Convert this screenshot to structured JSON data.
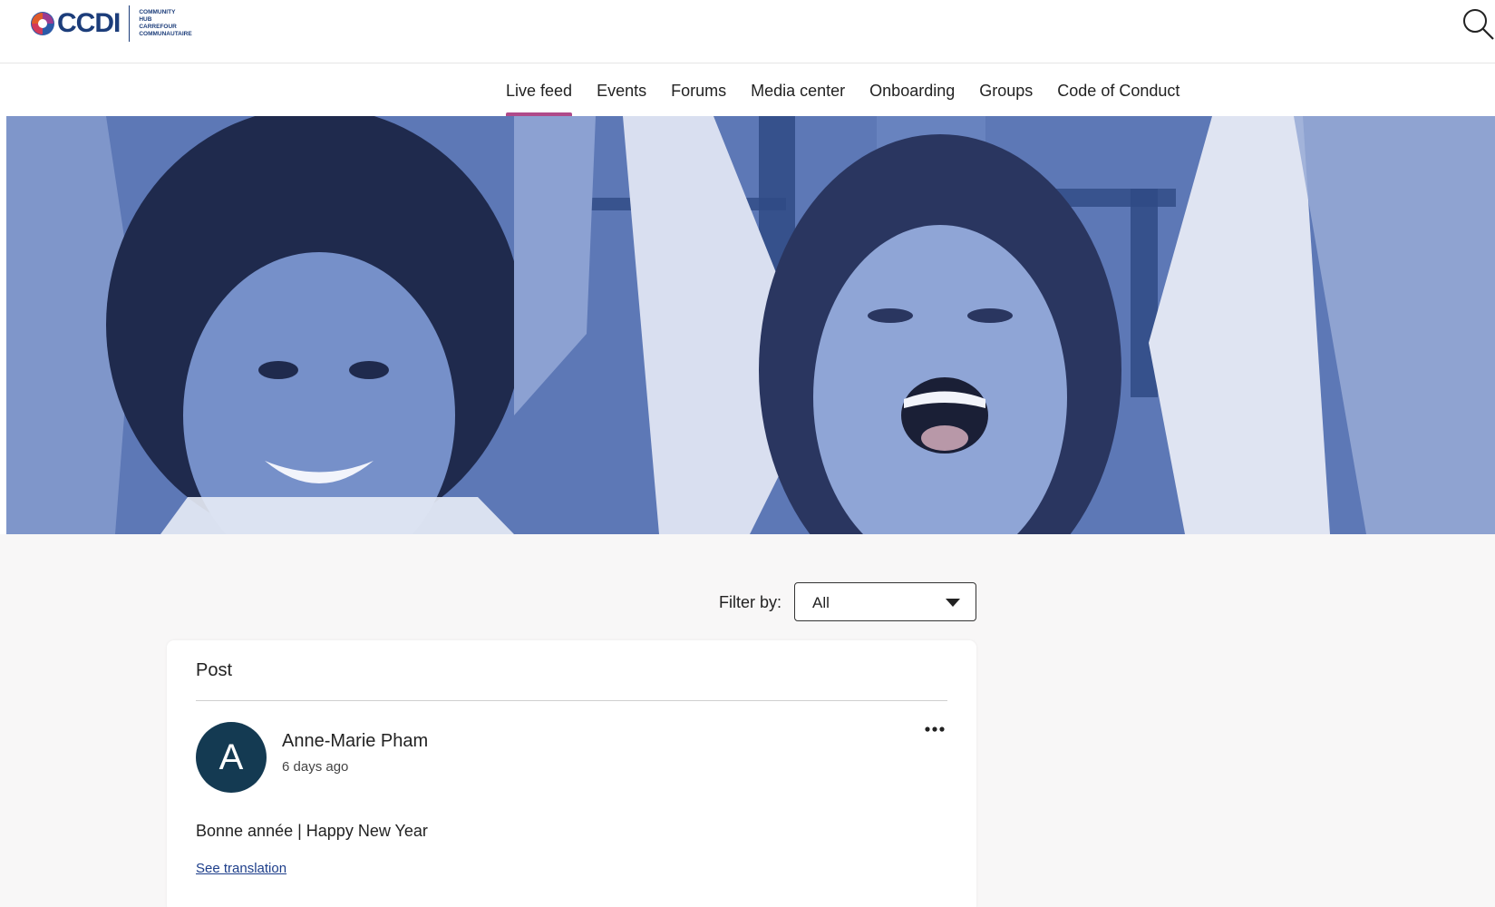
{
  "header": {
    "logo_text": "CCDI",
    "logo_sub": [
      "COMMUNITY",
      "HUB",
      "CARREFOUR",
      "COMMUNAUTAIRE"
    ],
    "search_icon": "search-icon"
  },
  "nav": {
    "items": [
      {
        "label": "Live feed",
        "active": true
      },
      {
        "label": "Events"
      },
      {
        "label": "Forums"
      },
      {
        "label": "Media center"
      },
      {
        "label": "Onboarding"
      },
      {
        "label": "Groups"
      },
      {
        "label": "Code of Conduct"
      }
    ],
    "active_color": "#b04a8a"
  },
  "filter": {
    "label": "Filter by:",
    "selected": "All"
  },
  "post_card": {
    "section_title": "Post",
    "avatar_letter": "A",
    "avatar_color": "#143a52",
    "author": "Anne-Marie Pham",
    "time": "6 days ago",
    "more_icon": "more-horizontal-icon",
    "text": "Bonne année | Happy New Year",
    "translate_link": "See translation"
  },
  "colors": {
    "hero_tint": "#5b76b4",
    "brand": "#1c3d7a",
    "link": "#1d3e8a"
  }
}
